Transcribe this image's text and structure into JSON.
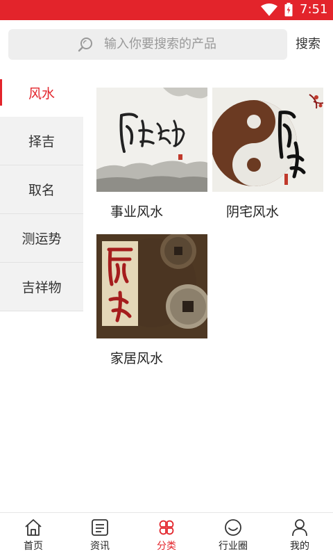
{
  "status_bar": {
    "time": "7:51",
    "wifi_icon": "wifi-icon",
    "battery_icon": "battery-charging-icon",
    "background": "#e3242b"
  },
  "search": {
    "placeholder": "输入你要搜索的产品",
    "button_label": "搜索",
    "icon": "search-icon"
  },
  "sidebar": {
    "items": [
      {
        "label": "风水",
        "active": true
      },
      {
        "label": "择吉",
        "active": false
      },
      {
        "label": "取名",
        "active": false
      },
      {
        "label": "测运势",
        "active": false
      },
      {
        "label": "吉祥物",
        "active": false
      }
    ]
  },
  "products": [
    {
      "title": "事业风水",
      "image": "calligraphy-painting"
    },
    {
      "title": "阴宅风水",
      "image": "yin-yang-calligraphy"
    },
    {
      "title": "家居风水",
      "image": "feng-shui-coins"
    }
  ],
  "bottom_nav": {
    "items": [
      {
        "label": "首页",
        "icon": "home-icon",
        "active": false
      },
      {
        "label": "资讯",
        "icon": "news-icon",
        "active": false
      },
      {
        "label": "分类",
        "icon": "category-icon",
        "active": true
      },
      {
        "label": "行业圈",
        "icon": "smile-icon",
        "active": false
      },
      {
        "label": "我的",
        "icon": "user-icon",
        "active": false
      }
    ]
  },
  "colors": {
    "accent": "#e3242b",
    "sidebar_bg": "#f2f2f2",
    "search_bg": "#eeeeee"
  }
}
